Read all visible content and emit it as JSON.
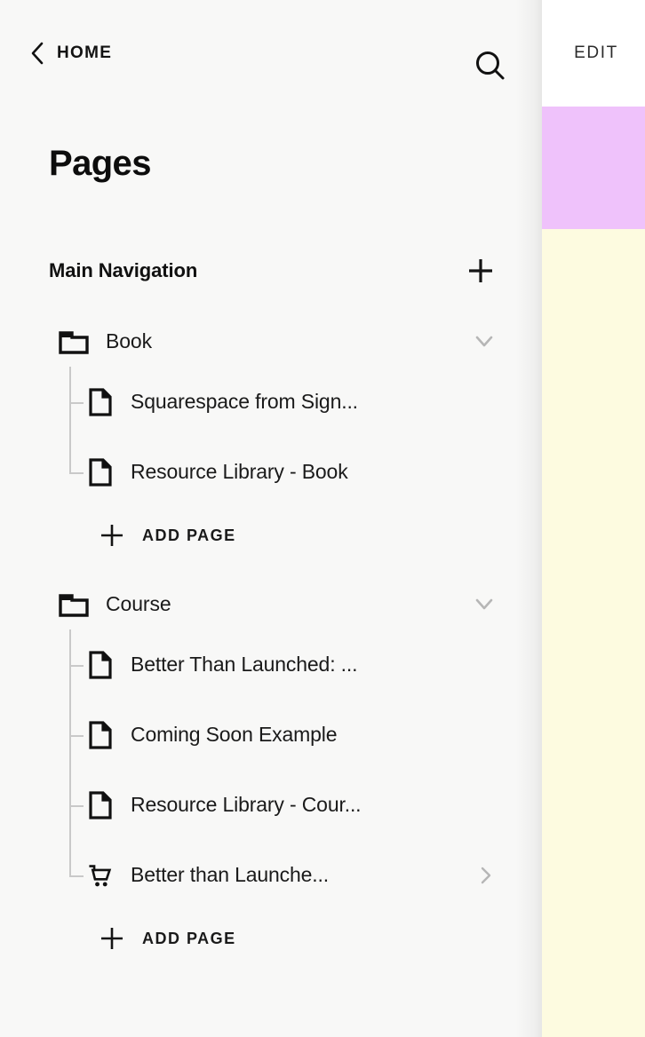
{
  "preview": {
    "edit_label": "EDIT",
    "topbar_color": "#ffffff",
    "band_color": "#efc2fb",
    "body_color": "#fdfbe0"
  },
  "header": {
    "back_label": "HOME",
    "back_icon": "chevron-left-icon",
    "search_icon": "search-icon"
  },
  "page_title": "Pages",
  "section": {
    "title": "Main Navigation",
    "add_icon": "plus-icon"
  },
  "groups": [
    {
      "name": "Book",
      "icon": "folder-icon",
      "collapse_icon": "chevron-down-icon",
      "pages": [
        {
          "label": "Squarespace from Sign...",
          "icon": "page-icon"
        },
        {
          "label": "Resource Library - Book",
          "icon": "page-icon"
        }
      ],
      "add_page_label": "ADD PAGE"
    },
    {
      "name": "Course",
      "icon": "folder-icon",
      "collapse_icon": "chevron-down-icon",
      "pages": [
        {
          "label": "Better Than Launched: ...",
          "icon": "page-icon"
        },
        {
          "label": "Coming Soon Example",
          "icon": "page-icon"
        },
        {
          "label": "Resource Library - Cour...",
          "icon": "page-icon"
        },
        {
          "label": "Better than Launche...",
          "icon": "cart-icon",
          "chevron": "chevron-right-icon"
        }
      ],
      "add_page_label": "ADD PAGE"
    }
  ],
  "colors": {
    "panel_bg": "#f8f8f7",
    "text": "#1a1a1a",
    "tree_line": "#c9c9c9",
    "chevron_muted": "#b6b6b6"
  }
}
